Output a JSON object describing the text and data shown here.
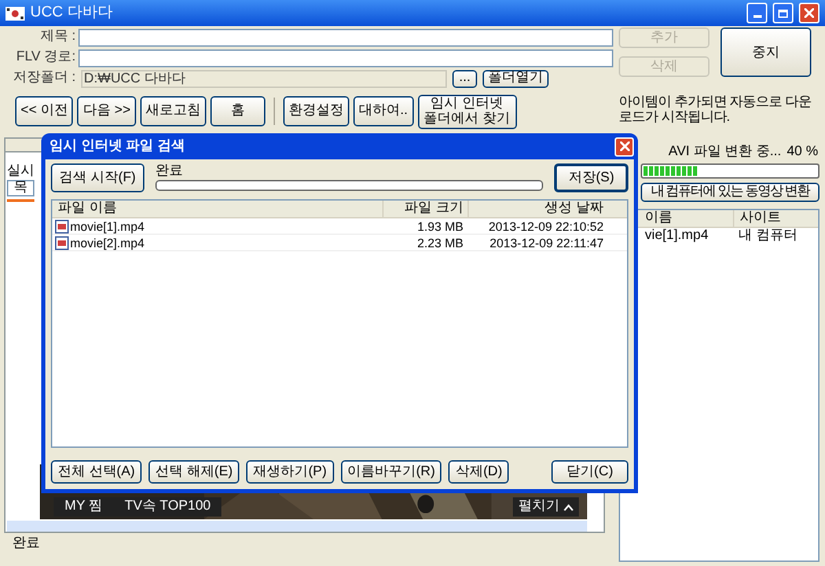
{
  "window": {
    "title": "UCC 다바다"
  },
  "form": {
    "fields": [
      {
        "label": "제목 :"
      },
      {
        "label": "FLV 경로:"
      }
    ],
    "folder": {
      "label": "저장폴더 :",
      "value": "D:₩UCC 다바다",
      "browse": "...",
      "open": "폴더열기"
    }
  },
  "toolbar": [
    {
      "label": "<< 이전"
    },
    {
      "label": "다음 >>"
    },
    {
      "label": "새로고침"
    },
    {
      "label": "홈"
    },
    {
      "label": "환경설정"
    },
    {
      "label": "대하여.."
    },
    {
      "label": "임시 인터넷 폴더에서 찾기"
    }
  ],
  "side": {
    "add": {
      "label": "추가",
      "disabled": true
    },
    "delete": {
      "label": "삭제",
      "disabled": true
    },
    "stop": {
      "label": "중지",
      "disabled": false
    },
    "notice": "아이템이 추가되면 자동으로 다운로드가 시작됩니다.",
    "conversion": {
      "status": "AVI 파일 변환 중...",
      "percent": "40 %",
      "level": 0.32
    },
    "convert_button": "내 컴퓨터에 있는 동영상 변환",
    "list": {
      "columns": [
        "이름",
        "사이트"
      ],
      "rows": [
        [
          "vie[1].mp4",
          "내 컴퓨터"
        ]
      ]
    }
  },
  "browser": {
    "label": "실시",
    "button": "목",
    "page_nav": [
      "MY 찜",
      "TV속 TOP100"
    ],
    "expand": "펼치기"
  },
  "status_bar": "완료",
  "dialog": {
    "title": "임시 인터넷 파일 검색",
    "search": "검색 시작(F)",
    "status": "완료",
    "level": 0,
    "save": "저장(S)",
    "columns": [
      "파일 이름",
      "파일 크기",
      "생성 날짜"
    ],
    "files": [
      {
        "name": "movie[1].mp4",
        "size": "1.93 MB",
        "created": "2013-12-09 22:10:52"
      },
      {
        "name": "movie[2].mp4",
        "size": "2.23 MB",
        "created": "2013-12-09 22:11:47"
      }
    ],
    "buttons": [
      "전체 선택(A)",
      "선택 해제(E)",
      "재생하기(P)",
      "이름바꾸기(R)",
      "삭제(D)"
    ],
    "close": "닫기(C)"
  }
}
